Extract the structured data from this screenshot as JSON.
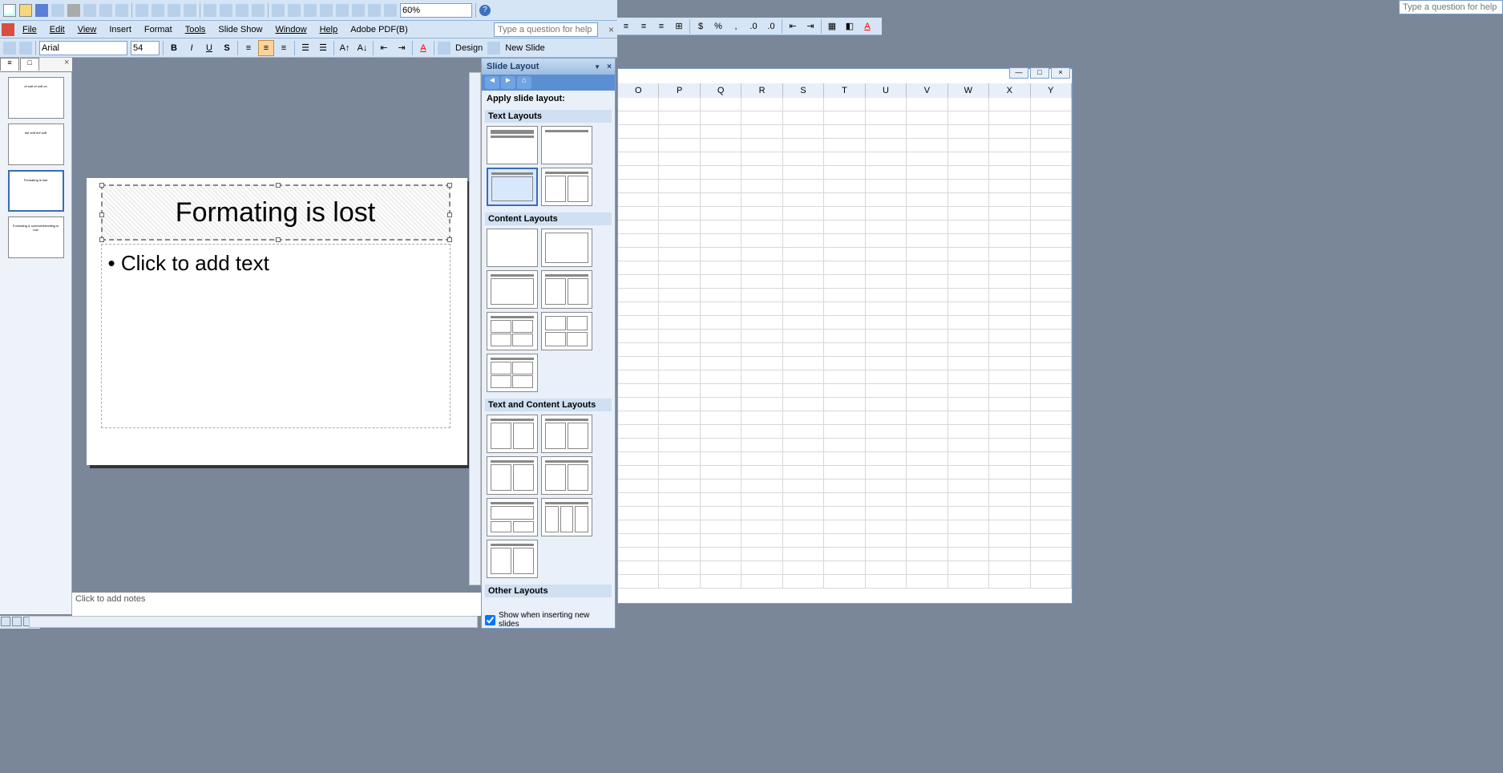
{
  "menu": {
    "items": [
      "File",
      "Edit",
      "View",
      "Insert",
      "Format",
      "Tools",
      "Slide Show",
      "Window",
      "Help",
      "Adobe PDF(B)"
    ],
    "help_placeholder": "Type a question for help"
  },
  "toolbar": {
    "zoom": "60%",
    "font_name": "Arial",
    "font_size": "54",
    "design_label": "Design",
    "new_slide_label": "New Slide"
  },
  "thumbs": [
    {
      "label": "of soft\nof soft on"
    },
    {
      "label": "dot soft\ndot soft"
    },
    {
      "label": "Formating is lost"
    },
    {
      "label": "Formating & somewhereelting is lost"
    }
  ],
  "slide": {
    "title": "Formating is lost",
    "body_placeholder": "Click to add text",
    "bullet": "•"
  },
  "notes": {
    "placeholder": "Click to add notes"
  },
  "task_pane": {
    "title": "Slide Layout",
    "apply_label": "Apply slide layout:",
    "sections": [
      "Text Layouts",
      "Content Layouts",
      "Text and Content Layouts",
      "Other Layouts"
    ],
    "footer_checkbox": "Show when inserting new slides",
    "footer_checked": true
  },
  "excel": {
    "columns": [
      "O",
      "P",
      "Q",
      "R",
      "S",
      "T",
      "U",
      "V",
      "W",
      "X",
      "Y"
    ],
    "row_count": 36,
    "help_placeholder": "Type a question for help",
    "wb_min": "—",
    "wb_max": "□",
    "wb_close": "×"
  }
}
